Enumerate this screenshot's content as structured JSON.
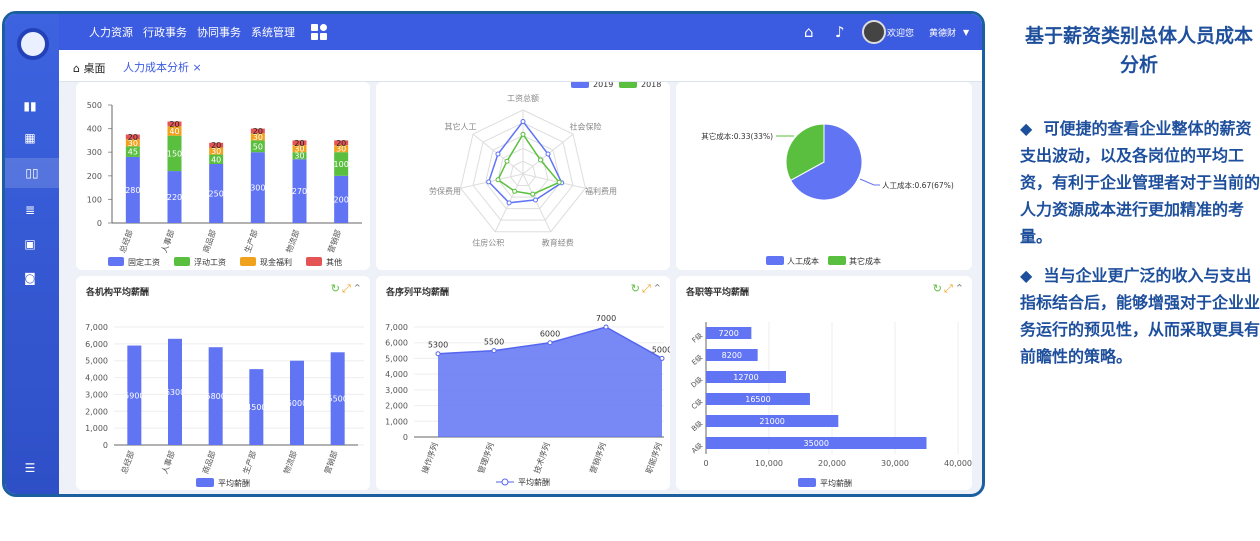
{
  "app": {
    "menu": [
      "人力资源",
      "行政事务",
      "协同事务",
      "系统管理"
    ],
    "user_welcome": "欢迎您",
    "user_name": "黄德财",
    "tabs": {
      "home": "桌面",
      "active": "人力成本分析",
      "close": "×"
    }
  },
  "colors": {
    "primary": "#3b5be0",
    "bar": "#6074f4",
    "fixed": "#6074f4",
    "float": "#5abf3f",
    "welfare": "#f0a21d",
    "other": "#e45454",
    "y2019": "#6074f4",
    "y2018": "#5abf3f"
  },
  "icons": [
    "home-icon",
    "bell-icon",
    "chevron-down-icon",
    "grid-icon",
    "refresh-icon",
    "expand-icon",
    "collapse-icon"
  ],
  "chart_data": [
    {
      "id": "stacked",
      "type": "bar",
      "categories": [
        "总经部",
        "人事部",
        "商品部",
        "生产部",
        "物流部",
        "营销部"
      ],
      "series": [
        {
          "name": "固定工资",
          "values": [
            280,
            220,
            250,
            300,
            270,
            200
          ]
        },
        {
          "name": "浮动工资",
          "values": [
            45,
            150,
            40,
            50,
            30,
            100
          ]
        },
        {
          "name": "现金福利",
          "values": [
            30,
            40,
            30,
            30,
            30,
            30
          ]
        },
        {
          "name": "其他",
          "values": [
            20,
            20,
            20,
            20,
            20,
            20
          ]
        }
      ],
      "yticks": [
        "500",
        "400",
        "300",
        "200",
        "100",
        "0"
      ],
      "ylim": [
        0,
        500
      ]
    },
    {
      "id": "radar",
      "type": "radar",
      "indicators": [
        "工资总额",
        "社会保险",
        "福利费用",
        "教育经费",
        "住房公积",
        "劳保费用",
        "其它人工"
      ],
      "series": [
        {
          "name": "2019",
          "values": [
            0.82,
            0.5,
            0.62,
            0.45,
            0.5,
            0.55,
            0.5
          ]
        },
        {
          "name": "2018",
          "values": [
            0.62,
            0.35,
            0.58,
            0.35,
            0.3,
            0.4,
            0.32
          ]
        }
      ]
    },
    {
      "id": "pie",
      "type": "pie",
      "slices": [
        {
          "name": "人工成本",
          "value": 0.67,
          "label": "人工成本:0.67(67%)"
        },
        {
          "name": "其它成本",
          "value": 0.33,
          "label": "其它成本:0.33(33%)"
        }
      ]
    },
    {
      "id": "org-avg",
      "type": "bar",
      "title": "各机构平均薪酬",
      "categories": [
        "总经部",
        "人事部",
        "商品部",
        "生产部",
        "物流部",
        "营销部"
      ],
      "series": [
        {
          "name": "平均薪酬",
          "values": [
            5900,
            6300,
            5800,
            4500,
            5000,
            5500
          ]
        }
      ],
      "yticks": [
        "7,000",
        "6,000",
        "5,000",
        "4,000",
        "3,000",
        "2,000",
        "1,000",
        "0"
      ],
      "ylim": [
        0,
        7000
      ]
    },
    {
      "id": "seq-avg",
      "type": "area",
      "title": "各序列平均薪酬",
      "categories": [
        "操作序列",
        "管理序列",
        "技术序列",
        "营销序列",
        "职能序列"
      ],
      "series": [
        {
          "name": "平均薪酬",
          "values": [
            5300,
            5500,
            6000,
            7000,
            5000
          ]
        }
      ],
      "yticks": [
        "7,000",
        "6,000",
        "5,000",
        "4,000",
        "3,000",
        "2,000",
        "1,000",
        "0"
      ],
      "ylim": [
        0,
        7000
      ]
    },
    {
      "id": "level-avg",
      "type": "bar",
      "title": "各职等平均薪酬",
      "orientation": "horizontal",
      "categories": [
        "F级",
        "E级",
        "D级",
        "C级",
        "B级",
        "A级"
      ],
      "series": [
        {
          "name": "平均薪酬",
          "values": [
            7200,
            8200,
            12700,
            16500,
            21000,
            35000
          ]
        }
      ],
      "xticks": [
        "0",
        "10,000",
        "20,000",
        "30,000",
        "40,000"
      ],
      "xlim": [
        0,
        40000
      ]
    }
  ],
  "legends": {
    "radar": [
      "2019",
      "2018"
    ],
    "pie": [
      "人工成本",
      "其它成本"
    ]
  },
  "side_panel": {
    "title": "基于薪资类别总体人员成本分析",
    "bullet": "◆",
    "points": [
      "可便捷的查看企业整体的薪资支出波动，以及各岗位的平均工资，有利于企业管理者对于当前的人力资源成本进行更加精准的考量。",
      "当与企业更广泛的收入与支出指标结合后，能够增强对于企业业务运行的预见性，从而采取更具有前瞻性的策略。"
    ]
  }
}
